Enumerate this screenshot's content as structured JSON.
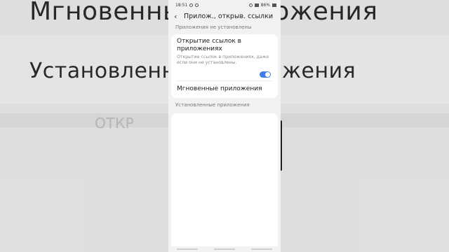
{
  "background": {
    "title_large": "Мгновенные приложения",
    "title_medium": "Установленные приложения",
    "blurred_text": "ОТКР"
  },
  "status_bar": {
    "time": "18:51",
    "battery": "86%"
  },
  "header": {
    "title": "Прилож., открыв. ссылки"
  },
  "sections": {
    "not_installed_label": "Приложения не установлены",
    "installed_label": "Установленные приложения"
  },
  "open_links": {
    "title": "Открытие ссылок в приложениях",
    "subtitle": "Открытие ссылок в приложениях, даже если они не установлены.",
    "enabled": true
  },
  "instant_apps": {
    "title": "Мгновенные приложения"
  },
  "colors": {
    "accent": "#3f7ee8"
  }
}
